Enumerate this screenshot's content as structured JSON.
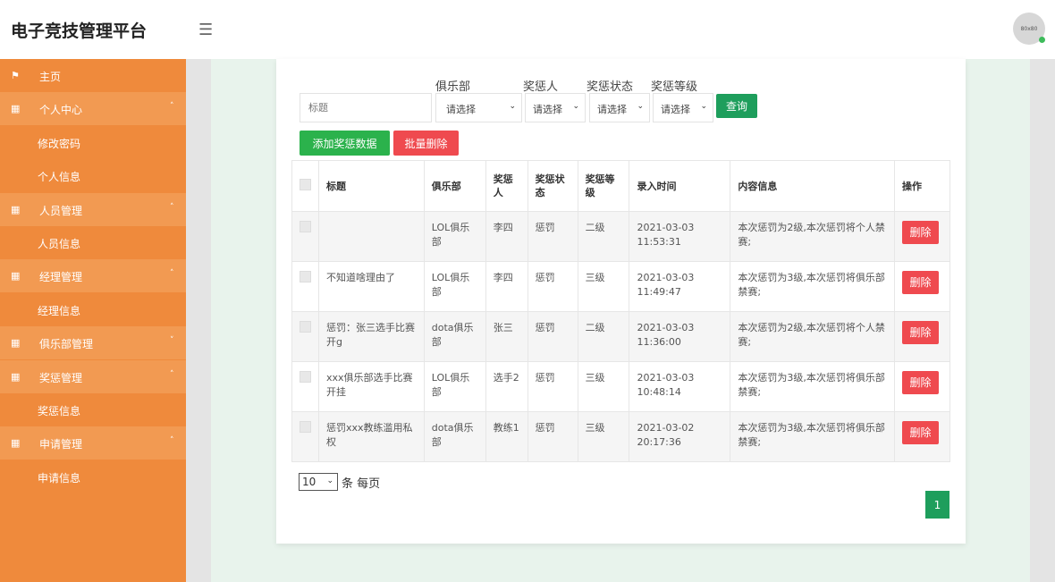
{
  "header": {
    "brand": "电子竞技管理平台",
    "menu_icon": "hamburger-icon",
    "avatar_text": "80x80"
  },
  "sidebar": {
    "items": [
      {
        "label": "主页",
        "icon": "flag-icon",
        "type": "top"
      },
      {
        "label": "个人中心",
        "icon": "grid-icon",
        "type": "group",
        "caret": "˄"
      },
      {
        "label": "修改密码",
        "type": "sub"
      },
      {
        "label": "个人信息",
        "type": "sub"
      },
      {
        "label": "人员管理",
        "icon": "grid-icon",
        "type": "group",
        "caret": "˄"
      },
      {
        "label": "人员信息",
        "type": "sub"
      },
      {
        "label": "经理管理",
        "icon": "grid-icon",
        "type": "group",
        "caret": "˄"
      },
      {
        "label": "经理信息",
        "type": "sub"
      },
      {
        "label": "俱乐部管理",
        "icon": "grid-icon",
        "type": "group",
        "caret": "˅"
      },
      {
        "label": "奖惩管理",
        "icon": "grid-icon",
        "type": "group",
        "caret": "˄"
      },
      {
        "label": "奖惩信息",
        "type": "sub"
      },
      {
        "label": "申请管理",
        "icon": "grid-icon",
        "type": "group",
        "caret": "˄"
      },
      {
        "label": "申请信息",
        "type": "sub"
      }
    ]
  },
  "filters": {
    "labels": {
      "club": "俱乐部",
      "person": "奖惩人",
      "status": "奖惩状态",
      "level": "奖惩等级"
    },
    "title_placeholder": "标题",
    "select_placeholder": "请选择",
    "query_label": "查询"
  },
  "actions": {
    "add_label": "添加奖惩数据",
    "batch_delete_label": "批量删除"
  },
  "table": {
    "headers": [
      "标题",
      "俱乐部",
      "奖惩人",
      "奖惩状态",
      "奖惩等级",
      "录入时间",
      "内容信息",
      "操作"
    ],
    "rows": [
      {
        "title": "",
        "club": "LOL俱乐部",
        "person": "李四",
        "status": "惩罚",
        "level": "二级",
        "time": "2021-03-03 11:53:31",
        "content": "本次惩罚为2级,本次惩罚将个人禁赛;"
      },
      {
        "title": "不知道啥理由了",
        "club": "LOL俱乐部",
        "person": "李四",
        "status": "惩罚",
        "level": "三级",
        "time": "2021-03-03 11:49:47",
        "content": "本次惩罚为3级,本次惩罚将俱乐部禁赛;"
      },
      {
        "title": "惩罚：张三选手比赛开g",
        "club": "dota俱乐部",
        "person": "张三",
        "status": "惩罚",
        "level": "二级",
        "time": "2021-03-03 11:36:00",
        "content": "本次惩罚为2级,本次惩罚将个人禁赛;"
      },
      {
        "title": "xxx俱乐部选手比赛开挂",
        "club": "LOL俱乐部",
        "person": "选手2",
        "status": "惩罚",
        "level": "三级",
        "time": "2021-03-03 10:48:14",
        "content": "本次惩罚为3级,本次惩罚将俱乐部禁赛;"
      },
      {
        "title": "惩罚xxx教练滥用私权",
        "club": "dota俱乐部",
        "person": "教练1",
        "status": "惩罚",
        "level": "三级",
        "time": "2021-03-02 20:17:36",
        "content": "本次惩罚为3级,本次惩罚将俱乐部禁赛;"
      }
    ],
    "delete_label": "删除"
  },
  "pagination": {
    "page_size": "10",
    "per_page_text": "条 每页",
    "current_page": "1"
  },
  "colors": {
    "sidebar": "#ef8a3c",
    "sidebar_group": "#f29a52",
    "primary_green": "#1e9e5c",
    "danger": "#ef4a4f"
  }
}
